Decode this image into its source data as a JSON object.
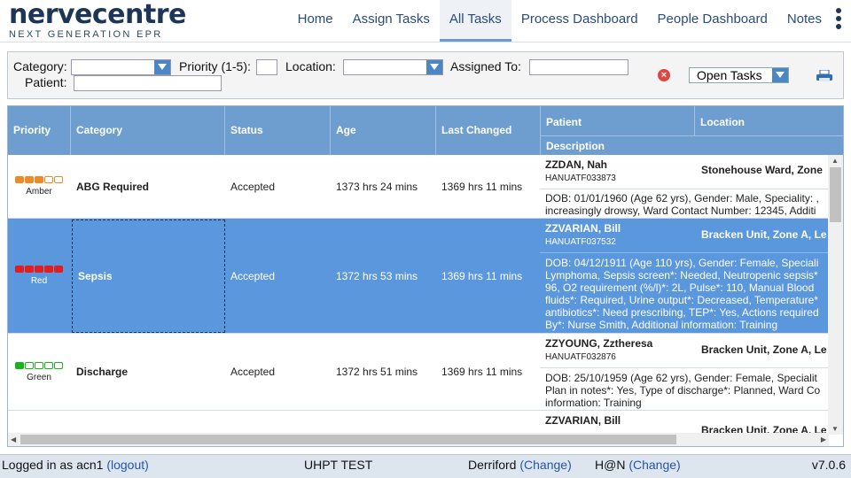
{
  "header": {
    "logo_main": "nervecentre",
    "logo_sub": "NEXT GENERATION EPR",
    "nav": [
      {
        "label": "Home"
      },
      {
        "label": "Assign Tasks"
      },
      {
        "label": "All Tasks"
      },
      {
        "label": "Process Dashboard"
      },
      {
        "label": "People Dashboard"
      },
      {
        "label": "Notes"
      }
    ]
  },
  "filters": {
    "category_label": "Category:",
    "priority_label": "Priority (1-5):",
    "location_label": "Location:",
    "assigned_label": "Assigned To:",
    "patient_label": "Patient:",
    "task_filter": "Open Tasks"
  },
  "columns": {
    "priority": "Priority",
    "category": "Category",
    "status": "Status",
    "age": "Age",
    "last_changed": "Last Changed",
    "patient": "Patient",
    "location": "Location",
    "description": "Description"
  },
  "rows": [
    {
      "priority_label": "Amber",
      "category": "ABG Required",
      "status": "Accepted",
      "age": "1373 hrs 24 mins",
      "last_changed": "1369 hrs 11 mins",
      "patient": "ZZDAN, Nah",
      "hospital_no": "HANUATF033873",
      "location": "Stonehouse Ward, Zone",
      "description": [
        "DOB: 01/01/1960 (Age 62 yrs), Gender: Male, Speciality: ,",
        "increasingly drowsy, Ward Contact Number: 12345, Additi"
      ]
    },
    {
      "priority_label": "Red",
      "category": "Sepsis",
      "status": "Accepted",
      "age": "1372 hrs 53 mins",
      "last_changed": "1369 hrs 11 mins",
      "patient": "ZZVARIAN, Bill",
      "hospital_no": "HANUATF037532",
      "location": "Bracken Unit, Zone A, Le",
      "description": [
        "DOB: 04/12/1911 (Age 110 yrs), Gender: Female, Speciali",
        "Lymphoma, Sepsis screen*: Needed, Neutropenic sepsis*",
        "96, O2 requirement (%/l)*: 2L, Pulse*: 110, Manual Blood",
        "fluids*: Required, Urine output*: Decreased, Temperature*",
        "antibiotics*: Need prescribing, TEP*: Yes, Actions required",
        "By*: Nurse Smith, Additional information: Training"
      ]
    },
    {
      "priority_label": "Green",
      "category": "Discharge",
      "status": "Accepted",
      "age": "1372 hrs 51 mins",
      "last_changed": "1369 hrs 11 mins",
      "patient": "ZZYOUNG, Zztheresa",
      "hospital_no": "HANUATF032876",
      "location": "Bracken Unit, Zone A, Le",
      "description": [
        "DOB: 25/10/1959 (Age 62 yrs), Gender: Female, Specialit",
        "Plan in notes*: Yes, Type of discharge*: Planned, Ward Co",
        "information: Training"
      ]
    },
    {
      "patient": "ZZVARIAN, Bill",
      "location": "Bracken Unit, Zone A, Le"
    }
  ],
  "footer": {
    "logged_in": "Logged in as acn1",
    "logout": "(logout)",
    "env": "UHPT TEST",
    "site": "Derriford",
    "site_change": "(Change)",
    "mode": "H@N",
    "mode_change": "(Change)",
    "version": "v7.0.6"
  },
  "colors": {
    "accent": "#6e9dcf",
    "selected_row": "#5b97dc",
    "amber": "#f08a24",
    "red": "#e02020",
    "green": "#18b418"
  },
  "icons": [
    "clear-filter-icon",
    "printer-icon",
    "kebab-menu-icon",
    "dropdown-arrow-icon"
  ]
}
